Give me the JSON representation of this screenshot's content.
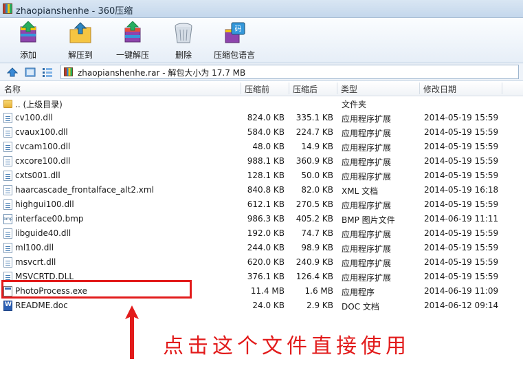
{
  "window": {
    "title": "zhaopianshenhe - 360压缩"
  },
  "toolbar": {
    "buttons": [
      {
        "label": "添加",
        "icon": "add-archive-icon"
      },
      {
        "label": "解压到",
        "icon": "extract-to-icon"
      },
      {
        "label": "一键解压",
        "icon": "one-click-extract-icon"
      },
      {
        "label": "删除",
        "icon": "delete-trash-icon"
      },
      {
        "label": "压缩包语言",
        "icon": "archive-language-icon"
      }
    ]
  },
  "address": {
    "text": "zhaopianshenhe.rar - 解包大小为 17.7 MB"
  },
  "columns": {
    "name": "名称",
    "compressed": "压缩前",
    "packed": "压缩后",
    "type": "类型",
    "modified": "修改日期"
  },
  "files": [
    {
      "name": ".. (上级目录)",
      "compressed": "",
      "packed": "",
      "type": "文件夹",
      "modified": "",
      "icon": "folder-icon"
    },
    {
      "name": "cv100.dll",
      "compressed": "824.0 KB",
      "packed": "335.1 KB",
      "type": "应用程序扩展",
      "modified": "2014-05-19 15:59",
      "icon": "dll-file-icon"
    },
    {
      "name": "cvaux100.dll",
      "compressed": "584.0 KB",
      "packed": "224.7 KB",
      "type": "应用程序扩展",
      "modified": "2014-05-19 15:59",
      "icon": "dll-file-icon"
    },
    {
      "name": "cvcam100.dll",
      "compressed": "48.0 KB",
      "packed": "14.9 KB",
      "type": "应用程序扩展",
      "modified": "2014-05-19 15:59",
      "icon": "dll-file-icon"
    },
    {
      "name": "cxcore100.dll",
      "compressed": "988.1 KB",
      "packed": "360.9 KB",
      "type": "应用程序扩展",
      "modified": "2014-05-19 15:59",
      "icon": "dll-file-icon"
    },
    {
      "name": "cxts001.dll",
      "compressed": "128.1 KB",
      "packed": "50.0 KB",
      "type": "应用程序扩展",
      "modified": "2014-05-19 15:59",
      "icon": "dll-file-icon"
    },
    {
      "name": "haarcascade_frontalface_alt2.xml",
      "compressed": "840.8 KB",
      "packed": "82.0 KB",
      "type": "XML 文档",
      "modified": "2014-05-19 16:18",
      "icon": "xml-file-icon"
    },
    {
      "name": "highgui100.dll",
      "compressed": "612.1 KB",
      "packed": "270.5 KB",
      "type": "应用程序扩展",
      "modified": "2014-05-19 15:59",
      "icon": "dll-file-icon"
    },
    {
      "name": "interface00.bmp",
      "compressed": "986.3 KB",
      "packed": "405.2 KB",
      "type": "BMP 图片文件",
      "modified": "2014-06-19 11:11",
      "icon": "bmp-file-icon"
    },
    {
      "name": "libguide40.dll",
      "compressed": "192.0 KB",
      "packed": "74.7 KB",
      "type": "应用程序扩展",
      "modified": "2014-05-19 15:59",
      "icon": "dll-file-icon"
    },
    {
      "name": "ml100.dll",
      "compressed": "244.0 KB",
      "packed": "98.9 KB",
      "type": "应用程序扩展",
      "modified": "2014-05-19 15:59",
      "icon": "dll-file-icon"
    },
    {
      "name": "msvcrt.dll",
      "compressed": "620.0 KB",
      "packed": "240.9 KB",
      "type": "应用程序扩展",
      "modified": "2014-05-19 15:59",
      "icon": "dll-file-icon"
    },
    {
      "name": "MSVCRTD.DLL",
      "compressed": "376.1 KB",
      "packed": "126.4 KB",
      "type": "应用程序扩展",
      "modified": "2014-05-19 15:59",
      "icon": "dll-file-icon"
    },
    {
      "name": "PhotoProcess.exe",
      "compressed": "11.4 MB",
      "packed": "1.6 MB",
      "type": "应用程序",
      "modified": "2014-06-19 11:09",
      "icon": "exe-file-icon"
    },
    {
      "name": "README.doc",
      "compressed": "24.0 KB",
      "packed": "2.9 KB",
      "type": "DOC 文档",
      "modified": "2014-06-12 09:14",
      "icon": "doc-file-icon"
    }
  ],
  "annotation": {
    "text": "点击这个文件直接使用",
    "color": "#e21b1b"
  }
}
